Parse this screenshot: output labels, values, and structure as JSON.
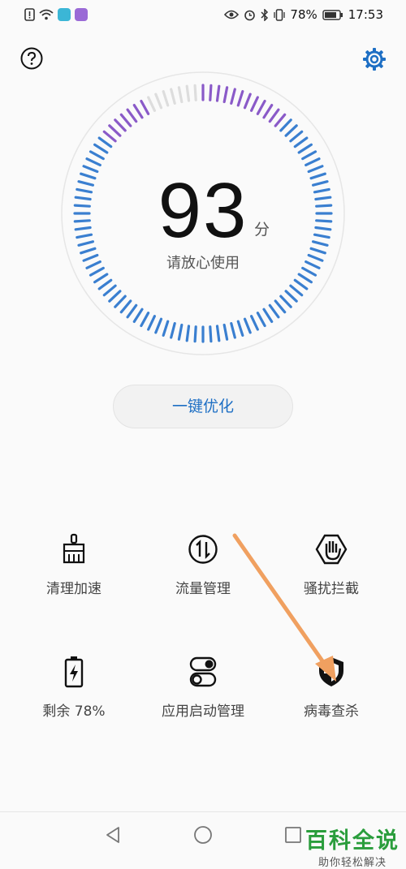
{
  "status_bar": {
    "battery_percent": "78%",
    "time": "17:53",
    "icons": [
      "alert-icon",
      "wifi-icon",
      "chat-app-icon",
      "app-icon",
      "eye-icon",
      "alarm-icon",
      "bluetooth-icon",
      "vibrate-icon",
      "battery-icon"
    ]
  },
  "header": {
    "help_icon": "question-circle-icon",
    "settings_icon": "gear-icon"
  },
  "score": {
    "value": "93",
    "unit": "分",
    "message": "请放心使用",
    "level": 0.93
  },
  "optimize_button": {
    "label": "一键优化"
  },
  "tools": [
    {
      "label": "清理加速",
      "icon": "broom-icon"
    },
    {
      "label": "流量管理",
      "icon": "data-arrows-icon"
    },
    {
      "label": "骚扰拦截",
      "icon": "hand-block-icon"
    },
    {
      "label": "剩余 78%",
      "icon": "battery-charging-icon"
    },
    {
      "label": "应用启动管理",
      "icon": "toggle-switches-icon"
    },
    {
      "label": "病毒查杀",
      "icon": "shield-icon"
    }
  ],
  "nav": {
    "icons": [
      "back-icon",
      "home-icon",
      "recents-icon"
    ]
  },
  "watermark": {
    "title": "百科全说",
    "subtitle": "助你轻松解决"
  },
  "colors": {
    "accent": "#1e6fc4",
    "gauge_blue": "#3a7fd0",
    "gauge_purple": "#8a5ac8",
    "gauge_gray": "#dddddd",
    "arrow": "#f0a060",
    "watermark_green": "#2a9d3c"
  }
}
